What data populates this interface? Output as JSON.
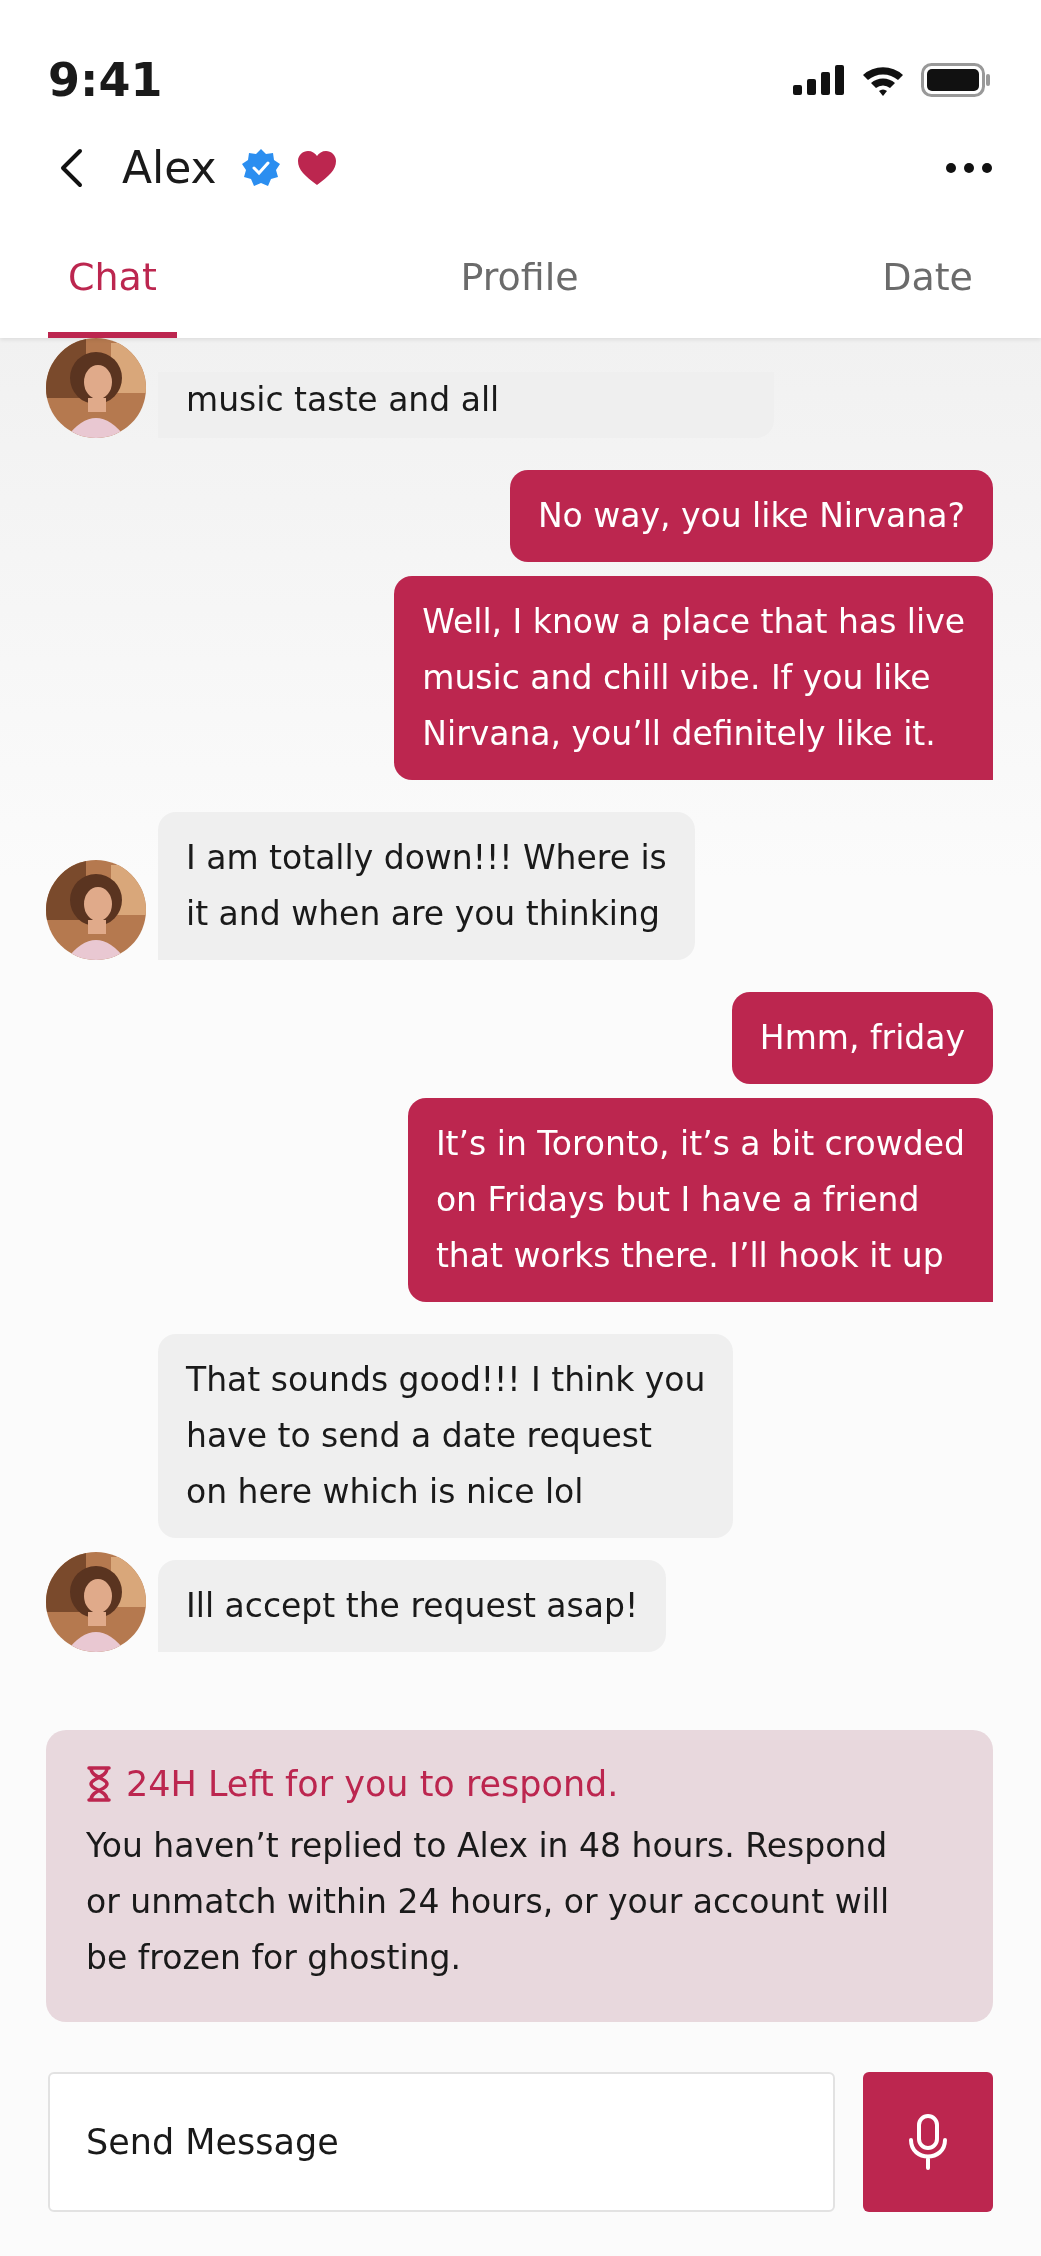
{
  "status_bar": {
    "time": "9:41"
  },
  "header": {
    "name": "Alex",
    "verified": true,
    "favorite": true
  },
  "tabs": [
    {
      "label": "Chat",
      "selected": true
    },
    {
      "label": "Profile",
      "selected": false
    },
    {
      "label": "Date",
      "selected": false
    }
  ],
  "messages": [
    {
      "kind": "received",
      "text": "music taste and all",
      "avatar": true,
      "tail": true,
      "cut": true
    },
    {
      "kind": "sent",
      "text": "No way, you like Nirvana?",
      "tail": false
    },
    {
      "kind": "sent",
      "text": "Well, I know a place that has live\nmusic and chill vibe. If you like\nNirvana, you’ll definitely like it.",
      "tail": true
    },
    {
      "kind": "received",
      "text": "I am totally down!!! Where is\nit and when are you thinking",
      "avatar": true,
      "tail": true
    },
    {
      "kind": "sent",
      "text": "Hmm, friday",
      "tail": false
    },
    {
      "kind": "sent",
      "text": "It’s in Toronto, it’s a bit crowded\non Fridays but I have a friend\nthat works there. I’ll hook it up",
      "tail": true
    },
    {
      "kind": "received",
      "text": "That sounds good!!! I think you\nhave to send a date request\non here which is nice lol",
      "avatar": false,
      "tail": false
    },
    {
      "kind": "received",
      "text": "Ill accept the request asap!",
      "avatar": true,
      "tail": true
    }
  ],
  "alert": {
    "title": "24H Left for you to respond.",
    "body": "You haven’t replied to Alex in 48 hours. Respond\nor unmatch within 24 hours, or your account will\nbe frozen for ghosting."
  },
  "composer": {
    "placeholder": "Send Message"
  }
}
